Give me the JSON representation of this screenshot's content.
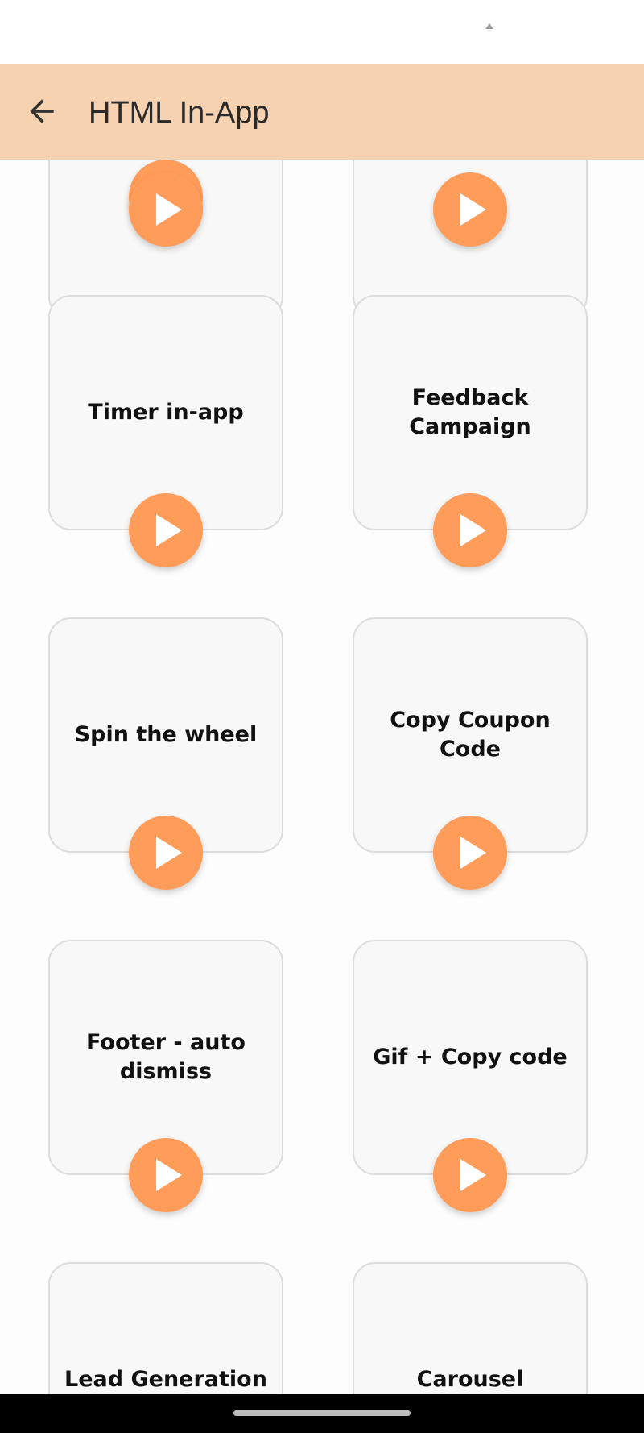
{
  "app_bar": {
    "title": "HTML In-App",
    "back_icon": "arrow-left-icon"
  },
  "cards": [
    {
      "label": ""
    },
    {
      "label": ""
    },
    {
      "label": "Timer in-app"
    },
    {
      "label": "Feedback Campaign"
    },
    {
      "label": "Spin the wheel"
    },
    {
      "label": "Copy Coupon Code"
    },
    {
      "label": "Footer - auto dismiss"
    },
    {
      "label": "Gif + Copy code"
    },
    {
      "label": "Lead Generation"
    },
    {
      "label": "Carousel"
    }
  ],
  "colors": {
    "accent": "#ff9c5a",
    "app_bar": "#f6d2b0",
    "card_bg": "#f8f8f8",
    "card_border": "#dcdcdc"
  },
  "icons": {
    "play": "play-icon"
  }
}
